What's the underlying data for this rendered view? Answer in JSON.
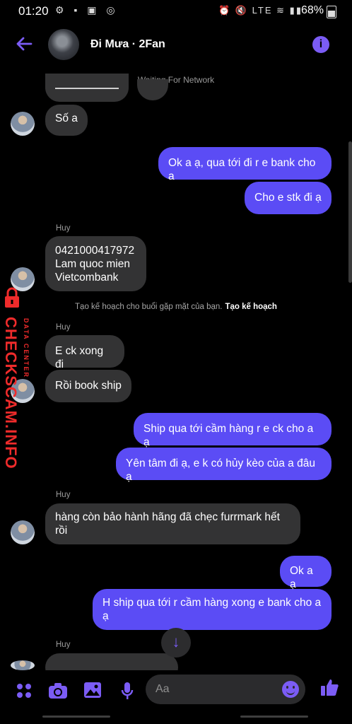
{
  "status_bar": {
    "time": "01:20",
    "battery": "68%",
    "network": "LTE"
  },
  "header": {
    "name": "Đi Mưa · 2Fan"
  },
  "network_banner": "Waiting For Network",
  "messages": [
    {
      "dir": "in",
      "text": "Số a"
    },
    {
      "dir": "out",
      "text": "Ok a ạ, qua tới đi r e bank cho a"
    },
    {
      "dir": "out",
      "text": "Cho e stk đi ạ"
    },
    {
      "dir": "in",
      "sender": "Huy",
      "text_lines": [
        "0421000417972",
        "Lam quoc mien",
        "Vietcombank"
      ]
    },
    {
      "dir": "in",
      "sender": "Huy",
      "text": "E ck xong đi"
    },
    {
      "dir": "in",
      "text": "Rồi book ship"
    },
    {
      "dir": "out",
      "text": "Ship qua tới cầm hàng r e ck cho a ạ"
    },
    {
      "dir": "out",
      "text": "Yên tâm đi ạ, e k có hủy kèo của a đâu ạ"
    },
    {
      "dir": "in",
      "sender": "Huy",
      "text_lines": [
        "hàng còn bảo hành hãng đã chẹc furrmark hết",
        "rồi"
      ]
    },
    {
      "dir": "out",
      "text": "Ok a ạ"
    },
    {
      "dir": "out",
      "text_lines": [
        "H ship qua tới r cầm hàng xong e bank cho a",
        "ạ"
      ]
    },
    {
      "dir": "in",
      "sender": "Huy",
      "text": ""
    }
  ],
  "system_note": {
    "text": "Tạo kế hoạch cho buổi gặp mặt của bạn.",
    "link": "Tạo kế hoạch"
  },
  "watermark": {
    "main": "CHECKSCAM.INFO",
    "sub": "DATA CENTER"
  },
  "composer": {
    "placeholder": "Aa"
  },
  "colors": {
    "accent": "#5b4cf5",
    "incoming_bubble": "#333334",
    "background": "#000000",
    "watermark": "#ef2b2b"
  }
}
